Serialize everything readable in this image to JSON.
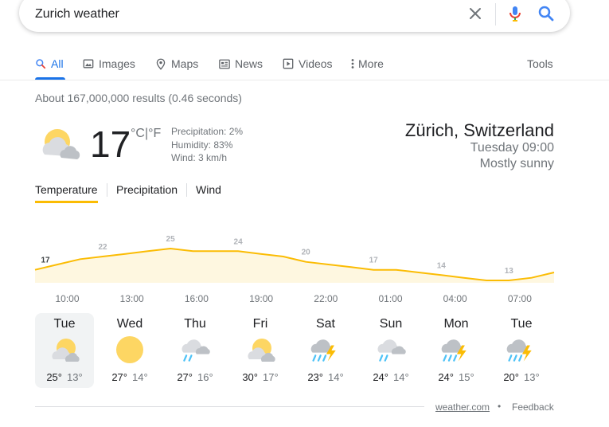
{
  "search": {
    "query": "Zurich weather"
  },
  "tabs": [
    {
      "label": "All",
      "icon": "search-icon",
      "active": true
    },
    {
      "label": "Images",
      "icon": "image-icon"
    },
    {
      "label": "Maps",
      "icon": "map-pin-icon"
    },
    {
      "label": "News",
      "icon": "news-icon"
    },
    {
      "label": "Videos",
      "icon": "video-icon"
    },
    {
      "label": "More",
      "icon": "more-vert-icon"
    }
  ],
  "tools_label": "Tools",
  "result_stats": "About 167,000,000 results (0.46 seconds)",
  "weather": {
    "temperature": "17",
    "unit_c": "°C",
    "unit_sep": "|",
    "unit_f": "°F",
    "precipitation": "Precipitation: 2%",
    "humidity": "Humidity: 83%",
    "wind": "Wind: 3 km/h",
    "location": "Zürich, Switzerland",
    "daytime": "Tuesday 09:00",
    "condition": "Mostly sunny",
    "current_icon": "partly-sunny-icon"
  },
  "subtabs": [
    "Temperature",
    "Precipitation",
    "Wind"
  ],
  "chart_data": {
    "type": "area",
    "x": [
      "09:00",
      "10:00",
      "11:00",
      "12:00",
      "13:00",
      "14:00",
      "15:00",
      "16:00",
      "17:00",
      "18:00",
      "19:00",
      "20:00",
      "21:00",
      "22:00",
      "23:00",
      "00:00",
      "01:00",
      "02:00",
      "03:00",
      "04:00",
      "05:00",
      "06:00",
      "07:00",
      "08:00"
    ],
    "values": [
      17,
      19,
      21,
      22,
      23,
      24,
      25,
      24,
      24,
      24,
      23,
      22,
      20,
      19,
      18,
      17,
      17,
      16,
      15,
      14,
      13,
      13,
      14,
      16
    ],
    "labeled": [
      {
        "index": 0,
        "label": "17"
      },
      {
        "index": 3,
        "label": "22"
      },
      {
        "index": 6,
        "label": "25"
      },
      {
        "index": 9,
        "label": "24"
      },
      {
        "index": 12,
        "label": "20"
      },
      {
        "index": 15,
        "label": "17"
      },
      {
        "index": 18,
        "label": "14"
      },
      {
        "index": 21,
        "label": "13"
      }
    ],
    "tick_labels": [
      "10:00",
      "13:00",
      "16:00",
      "19:00",
      "22:00",
      "01:00",
      "04:00",
      "07:00"
    ],
    "line_color": "#fbbc04",
    "fill_color": "#fef7e0"
  },
  "days": [
    {
      "name": "Tue",
      "icon": "partly-sunny-icon",
      "high": "25°",
      "low": "13°",
      "selected": true
    },
    {
      "name": "Wed",
      "icon": "sunny-icon",
      "high": "27°",
      "low": "14°"
    },
    {
      "name": "Thu",
      "icon": "rain-cloud-icon",
      "high": "27°",
      "low": "16°"
    },
    {
      "name": "Fri",
      "icon": "partly-sunny-icon",
      "high": "30°",
      "low": "17°"
    },
    {
      "name": "Sat",
      "icon": "thunderstorm-icon",
      "high": "23°",
      "low": "14°"
    },
    {
      "name": "Sun",
      "icon": "rain-cloud-icon",
      "high": "24°",
      "low": "14°"
    },
    {
      "name": "Mon",
      "icon": "thunderstorm-icon",
      "high": "24°",
      "low": "15°"
    },
    {
      "name": "Tue",
      "icon": "thunderstorm-icon",
      "high": "20°",
      "low": "13°"
    }
  ],
  "footer": {
    "source": "weather.com",
    "bullet": "•",
    "feedback": "Feedback"
  }
}
